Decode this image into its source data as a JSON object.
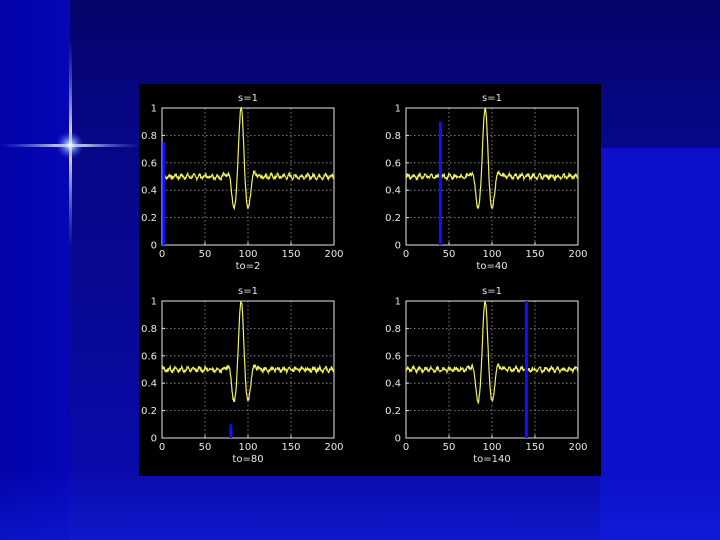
{
  "slide": {
    "accent_color": "#05057a",
    "sparkle_icon": "star-sparkle"
  },
  "chart_data": [
    {
      "type": "line",
      "title": "s=1",
      "xlabel": "to=2",
      "xlim": [
        0,
        200
      ],
      "ylim": [
        0,
        1
      ],
      "x_ticks": [
        0,
        50,
        100,
        150,
        200
      ],
      "y_ticks": [
        0,
        0.2,
        0.4,
        0.6,
        0.8,
        1
      ],
      "grid": true,
      "series": [
        {
          "kind": "wavelet",
          "color": "#f0f060",
          "center": 92,
          "baseline": 0.5
        },
        {
          "kind": "impulse",
          "color": "#1010ff",
          "x": 2,
          "y": 0.75
        }
      ]
    },
    {
      "type": "line",
      "title": "s=1",
      "xlabel": "to=40",
      "xlim": [
        0,
        200
      ],
      "ylim": [
        0,
        1
      ],
      "x_ticks": [
        0,
        50,
        100,
        150,
        200
      ],
      "y_ticks": [
        0,
        0.2,
        0.4,
        0.6,
        0.8,
        1
      ],
      "grid": true,
      "series": [
        {
          "kind": "wavelet",
          "color": "#f0f060",
          "center": 92,
          "baseline": 0.5
        },
        {
          "kind": "impulse",
          "color": "#1010ff",
          "x": 40,
          "y": 0.9
        }
      ]
    },
    {
      "type": "line",
      "title": "s=1",
      "xlabel": "to=80",
      "xlim": [
        0,
        200
      ],
      "ylim": [
        0,
        1
      ],
      "x_ticks": [
        0,
        50,
        100,
        150,
        200
      ],
      "y_ticks": [
        0,
        0.2,
        0.4,
        0.6,
        0.8,
        1
      ],
      "grid": true,
      "series": [
        {
          "kind": "wavelet",
          "color": "#f0f060",
          "center": 92,
          "baseline": 0.5
        },
        {
          "kind": "impulse",
          "color": "#1010ff",
          "x": 80,
          "y": 0.1
        }
      ]
    },
    {
      "type": "line",
      "title": "s=1",
      "xlabel": "to=140",
      "xlim": [
        0,
        200
      ],
      "ylim": [
        0,
        1
      ],
      "x_ticks": [
        0,
        50,
        100,
        150,
        200
      ],
      "y_ticks": [
        0,
        0.2,
        0.4,
        0.6,
        0.8,
        1
      ],
      "grid": true,
      "series": [
        {
          "kind": "wavelet",
          "color": "#f0f060",
          "center": 92,
          "baseline": 0.5
        },
        {
          "kind": "impulse",
          "color": "#1010ff",
          "x": 140,
          "y": 1.0
        }
      ]
    }
  ]
}
